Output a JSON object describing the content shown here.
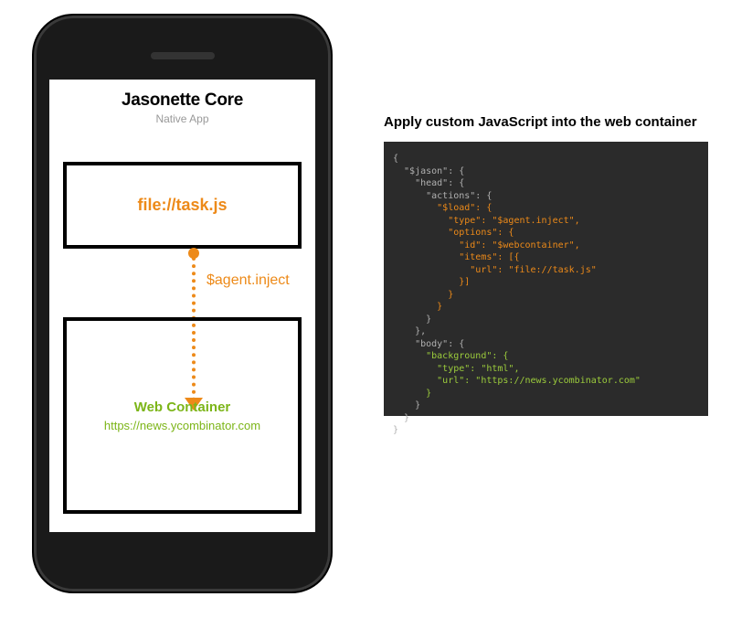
{
  "phone": {
    "title": "Jasonette Core",
    "subtitle": "Native App",
    "top_box_label": "file://task.js",
    "inject_label": "$agent.inject",
    "web_container_title": "Web Container",
    "web_container_url": "https://news.ycombinator.com"
  },
  "right": {
    "title": "Apply custom JavaScript into the web container"
  },
  "code": {
    "lines": [
      {
        "indent": 0,
        "cls": "c-punc",
        "text": "{"
      },
      {
        "indent": 1,
        "cls": "c-punc",
        "text": "\"$jason\": {"
      },
      {
        "indent": 2,
        "cls": "c-punc",
        "text": "\"head\": {"
      },
      {
        "indent": 3,
        "cls": "c-punc",
        "text": "\"actions\": {"
      },
      {
        "indent": 4,
        "cls": "c-head",
        "text": "\"$load\": {"
      },
      {
        "indent": 5,
        "cls": "c-head",
        "text": "\"type\": \"$agent.inject\","
      },
      {
        "indent": 5,
        "cls": "c-head",
        "text": "\"options\": {"
      },
      {
        "indent": 6,
        "cls": "c-head",
        "text": "\"id\": \"$webcontainer\","
      },
      {
        "indent": 6,
        "cls": "c-head",
        "text": "\"items\": [{"
      },
      {
        "indent": 7,
        "cls": "c-head",
        "text": "\"url\": \"file://task.js\""
      },
      {
        "indent": 6,
        "cls": "c-head",
        "text": "}]"
      },
      {
        "indent": 5,
        "cls": "c-head",
        "text": "}"
      },
      {
        "indent": 4,
        "cls": "c-head",
        "text": "}"
      },
      {
        "indent": 3,
        "cls": "c-punc",
        "text": "}"
      },
      {
        "indent": 2,
        "cls": "c-punc",
        "text": "},"
      },
      {
        "indent": 2,
        "cls": "c-punc",
        "text": "\"body\": {"
      },
      {
        "indent": 3,
        "cls": "c-body",
        "text": "\"background\": {"
      },
      {
        "indent": 4,
        "cls": "c-body",
        "text": "\"type\": \"html\","
      },
      {
        "indent": 4,
        "cls": "c-body",
        "text": "\"url\": \"https://news.ycombinator.com\""
      },
      {
        "indent": 3,
        "cls": "c-body",
        "text": "}"
      },
      {
        "indent": 2,
        "cls": "c-punc",
        "text": "}"
      },
      {
        "indent": 1,
        "cls": "c-punc",
        "text": "}"
      },
      {
        "indent": 0,
        "cls": "c-punc",
        "text": "}"
      }
    ]
  },
  "colors": {
    "accent": "#ed8a19",
    "green": "#7cb518",
    "code_bg": "#2b2b2b"
  }
}
